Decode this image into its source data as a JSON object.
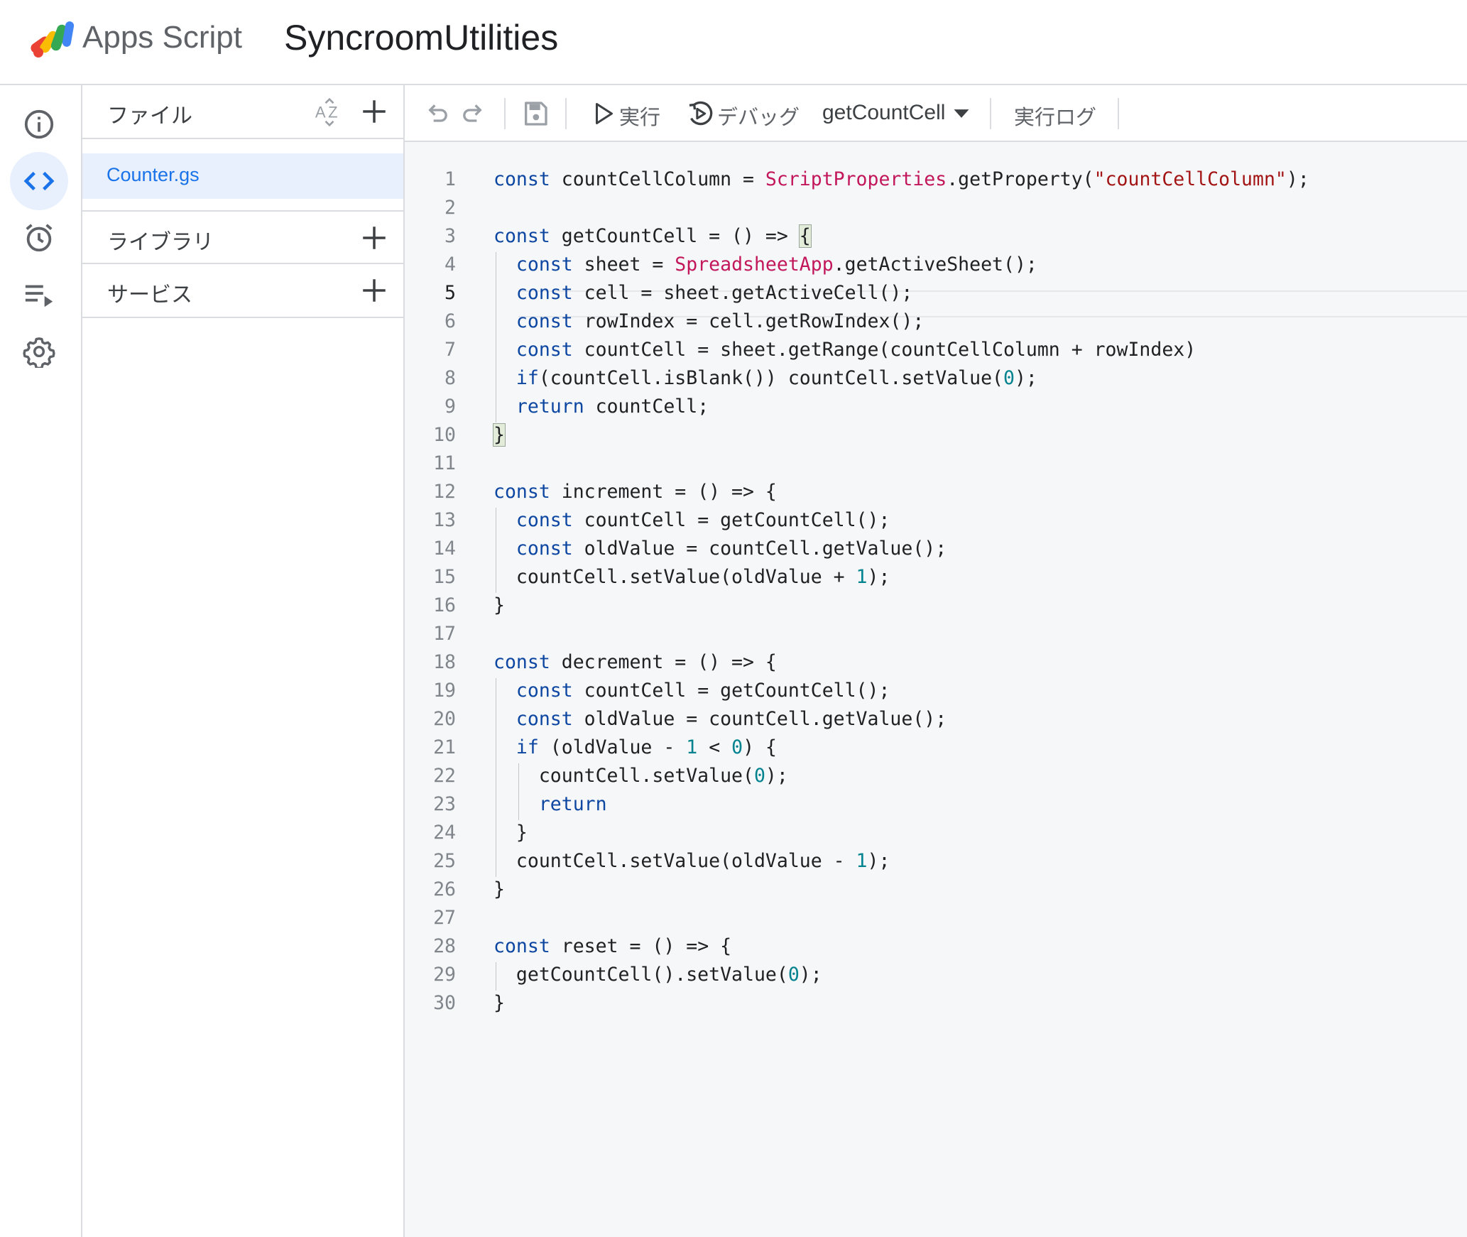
{
  "header": {
    "brand": "Apps Script",
    "project_name": "SyncroomUtilities"
  },
  "rail": {
    "icons": [
      "info-icon",
      "code-icon",
      "alarm-clock-icon",
      "executions-icon",
      "gear-icon"
    ],
    "active": "code-icon"
  },
  "panel": {
    "files_label": "ファイル",
    "files": [
      "Counter.gs"
    ],
    "libraries_label": "ライブラリ",
    "services_label": "サービス"
  },
  "toolbar": {
    "run_label": "実行",
    "debug_label": "デバッグ",
    "function_select": "getCountCell",
    "log_label": "実行ログ"
  },
  "editor": {
    "current_line": 5,
    "lines": [
      "const countCellColumn = ScriptProperties.getProperty(\"countCellColumn\");",
      "",
      "const getCountCell = () => {",
      "  const sheet = SpreadsheetApp.getActiveSheet();",
      "  const cell = sheet.getActiveCell();",
      "  const rowIndex = cell.getRowIndex();",
      "  const countCell = sheet.getRange(countCellColumn + rowIndex)",
      "  if(countCell.isBlank()) countCell.setValue(0);",
      "  return countCell;",
      "}",
      "",
      "const increment = () => {",
      "  const countCell = getCountCell();",
      "  const oldValue = countCell.getValue();",
      "  countCell.setValue(oldValue + 1);",
      "}",
      "",
      "const decrement = () => {",
      "  const countCell = getCountCell();",
      "  const oldValue = countCell.getValue();",
      "  if (oldValue - 1 < 0) {",
      "    countCell.setValue(0);",
      "    return",
      "  }",
      "  countCell.setValue(oldValue - 1);",
      "}",
      "",
      "const reset = () => {",
      "  getCountCell().setValue(0);",
      "}"
    ]
  }
}
